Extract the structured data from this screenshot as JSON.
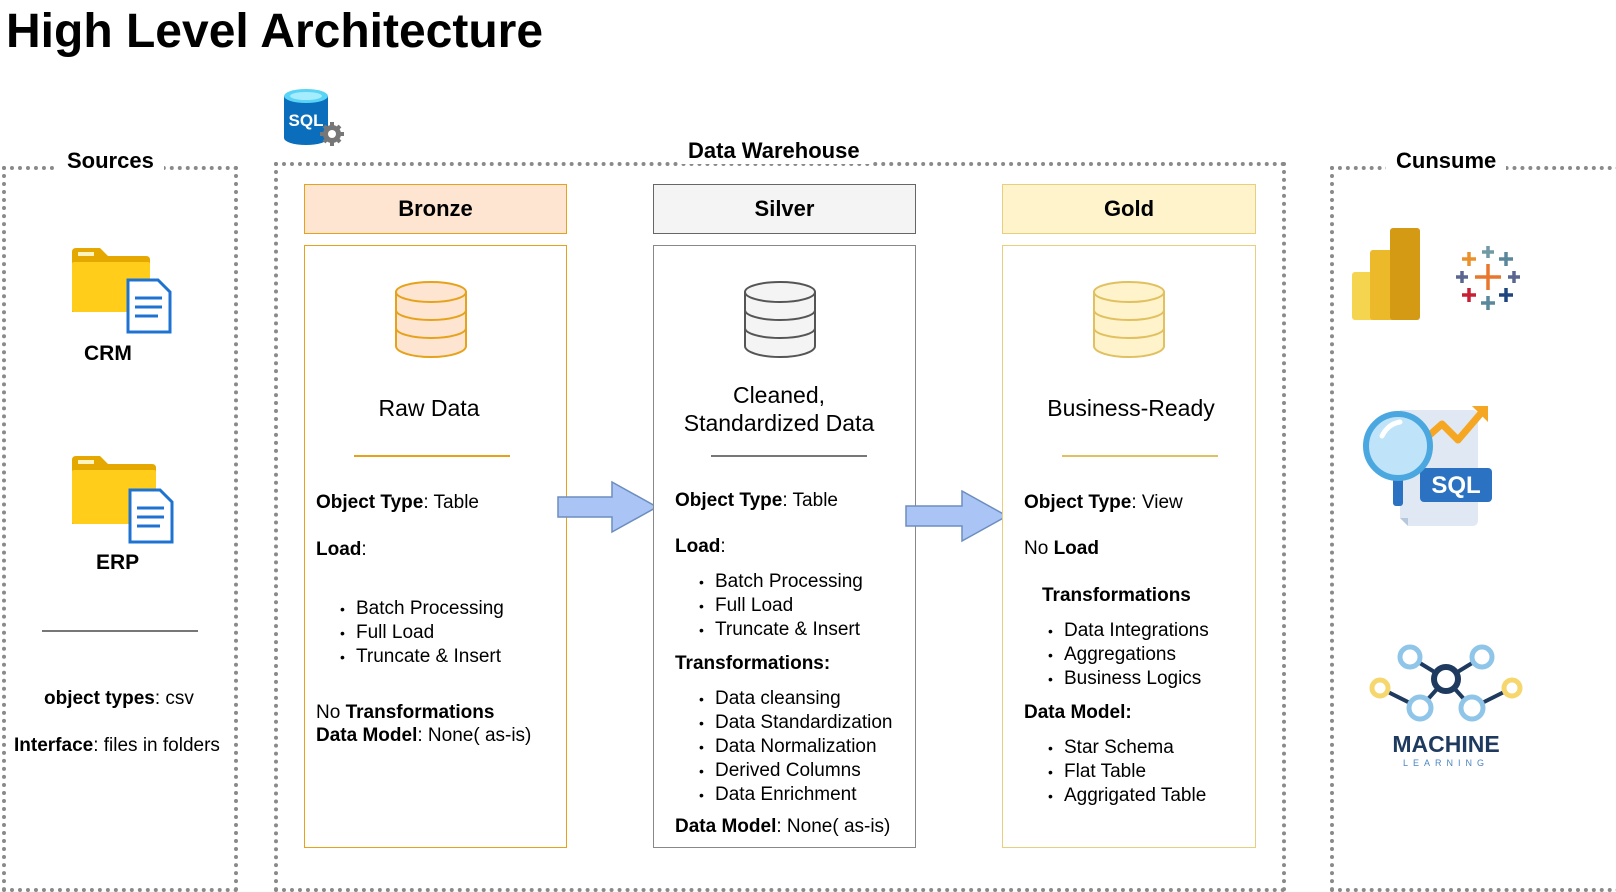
{
  "title": "High Level Architecture",
  "sources": {
    "label": "Sources",
    "crm_label": "CRM",
    "erp_label": "ERP",
    "object_types_key": "object types",
    "object_types_value": ": csv",
    "interface_key": "Interface",
    "interface_value": ": files in folders"
  },
  "warehouse": {
    "label": "Data Warehouse",
    "bronze": {
      "header": "Bronze",
      "description": "Raw Data",
      "object_type_key": "Object Type",
      "object_type_value": ": Table",
      "load_key": "Load",
      "load_colon": ":",
      "load_items": [
        "Batch Processing",
        "Full Load",
        "Truncate & Insert"
      ],
      "no_prefix": "No ",
      "transformations_key": "Transformations",
      "data_model_key": "Data Model",
      "data_model_value": ": None( as-is)"
    },
    "silver": {
      "header": "Silver",
      "description_line1": "Cleaned,",
      "description_line2": "Standardized Data",
      "object_type_key": "Object Type",
      "object_type_value": ": Table",
      "load_key": "Load",
      "load_colon": ":",
      "load_items": [
        "Batch Processing",
        "Full Load",
        "Truncate & Insert"
      ],
      "transformations_label": "Transformations:",
      "transformation_items": [
        "Data cleansing",
        "Data Standardization",
        "Data Normalization",
        "Derived Columns",
        "Data Enrichment"
      ],
      "data_model_key": "Data Model",
      "data_model_value": ": None( as-is)"
    },
    "gold": {
      "header": "Gold",
      "description": "Business-Ready",
      "object_type_key": "Object Type",
      "object_type_value": ": View",
      "no_prefix": "No ",
      "load_key": "Load",
      "transformations_label": "Transformations",
      "transformation_items": [
        "Data Integrations",
        "Aggregations",
        "Business Logics"
      ],
      "data_model_label": "Data Model:",
      "data_model_items": [
        "Star Schema",
        "Flat Table",
        "Aggrigated Table"
      ]
    }
  },
  "consume": {
    "label": "Cunsume",
    "sql_badge": "SQL",
    "ml_text": "MACHINE",
    "ml_subtext": "LEARNING"
  },
  "db_badge": "SQL",
  "colors": {
    "bronze_fill": "#fde5d2",
    "bronze_border": "#e6a21a",
    "silver_fill": "#f4f4f4",
    "silver_border": "#666666",
    "gold_fill": "#fff3cc",
    "gold_border": "#e8cf7e",
    "arrow_fill": "#a9c4f5",
    "arrow_stroke": "#6c8ebf",
    "dotted_border": "#8a8a8a"
  }
}
